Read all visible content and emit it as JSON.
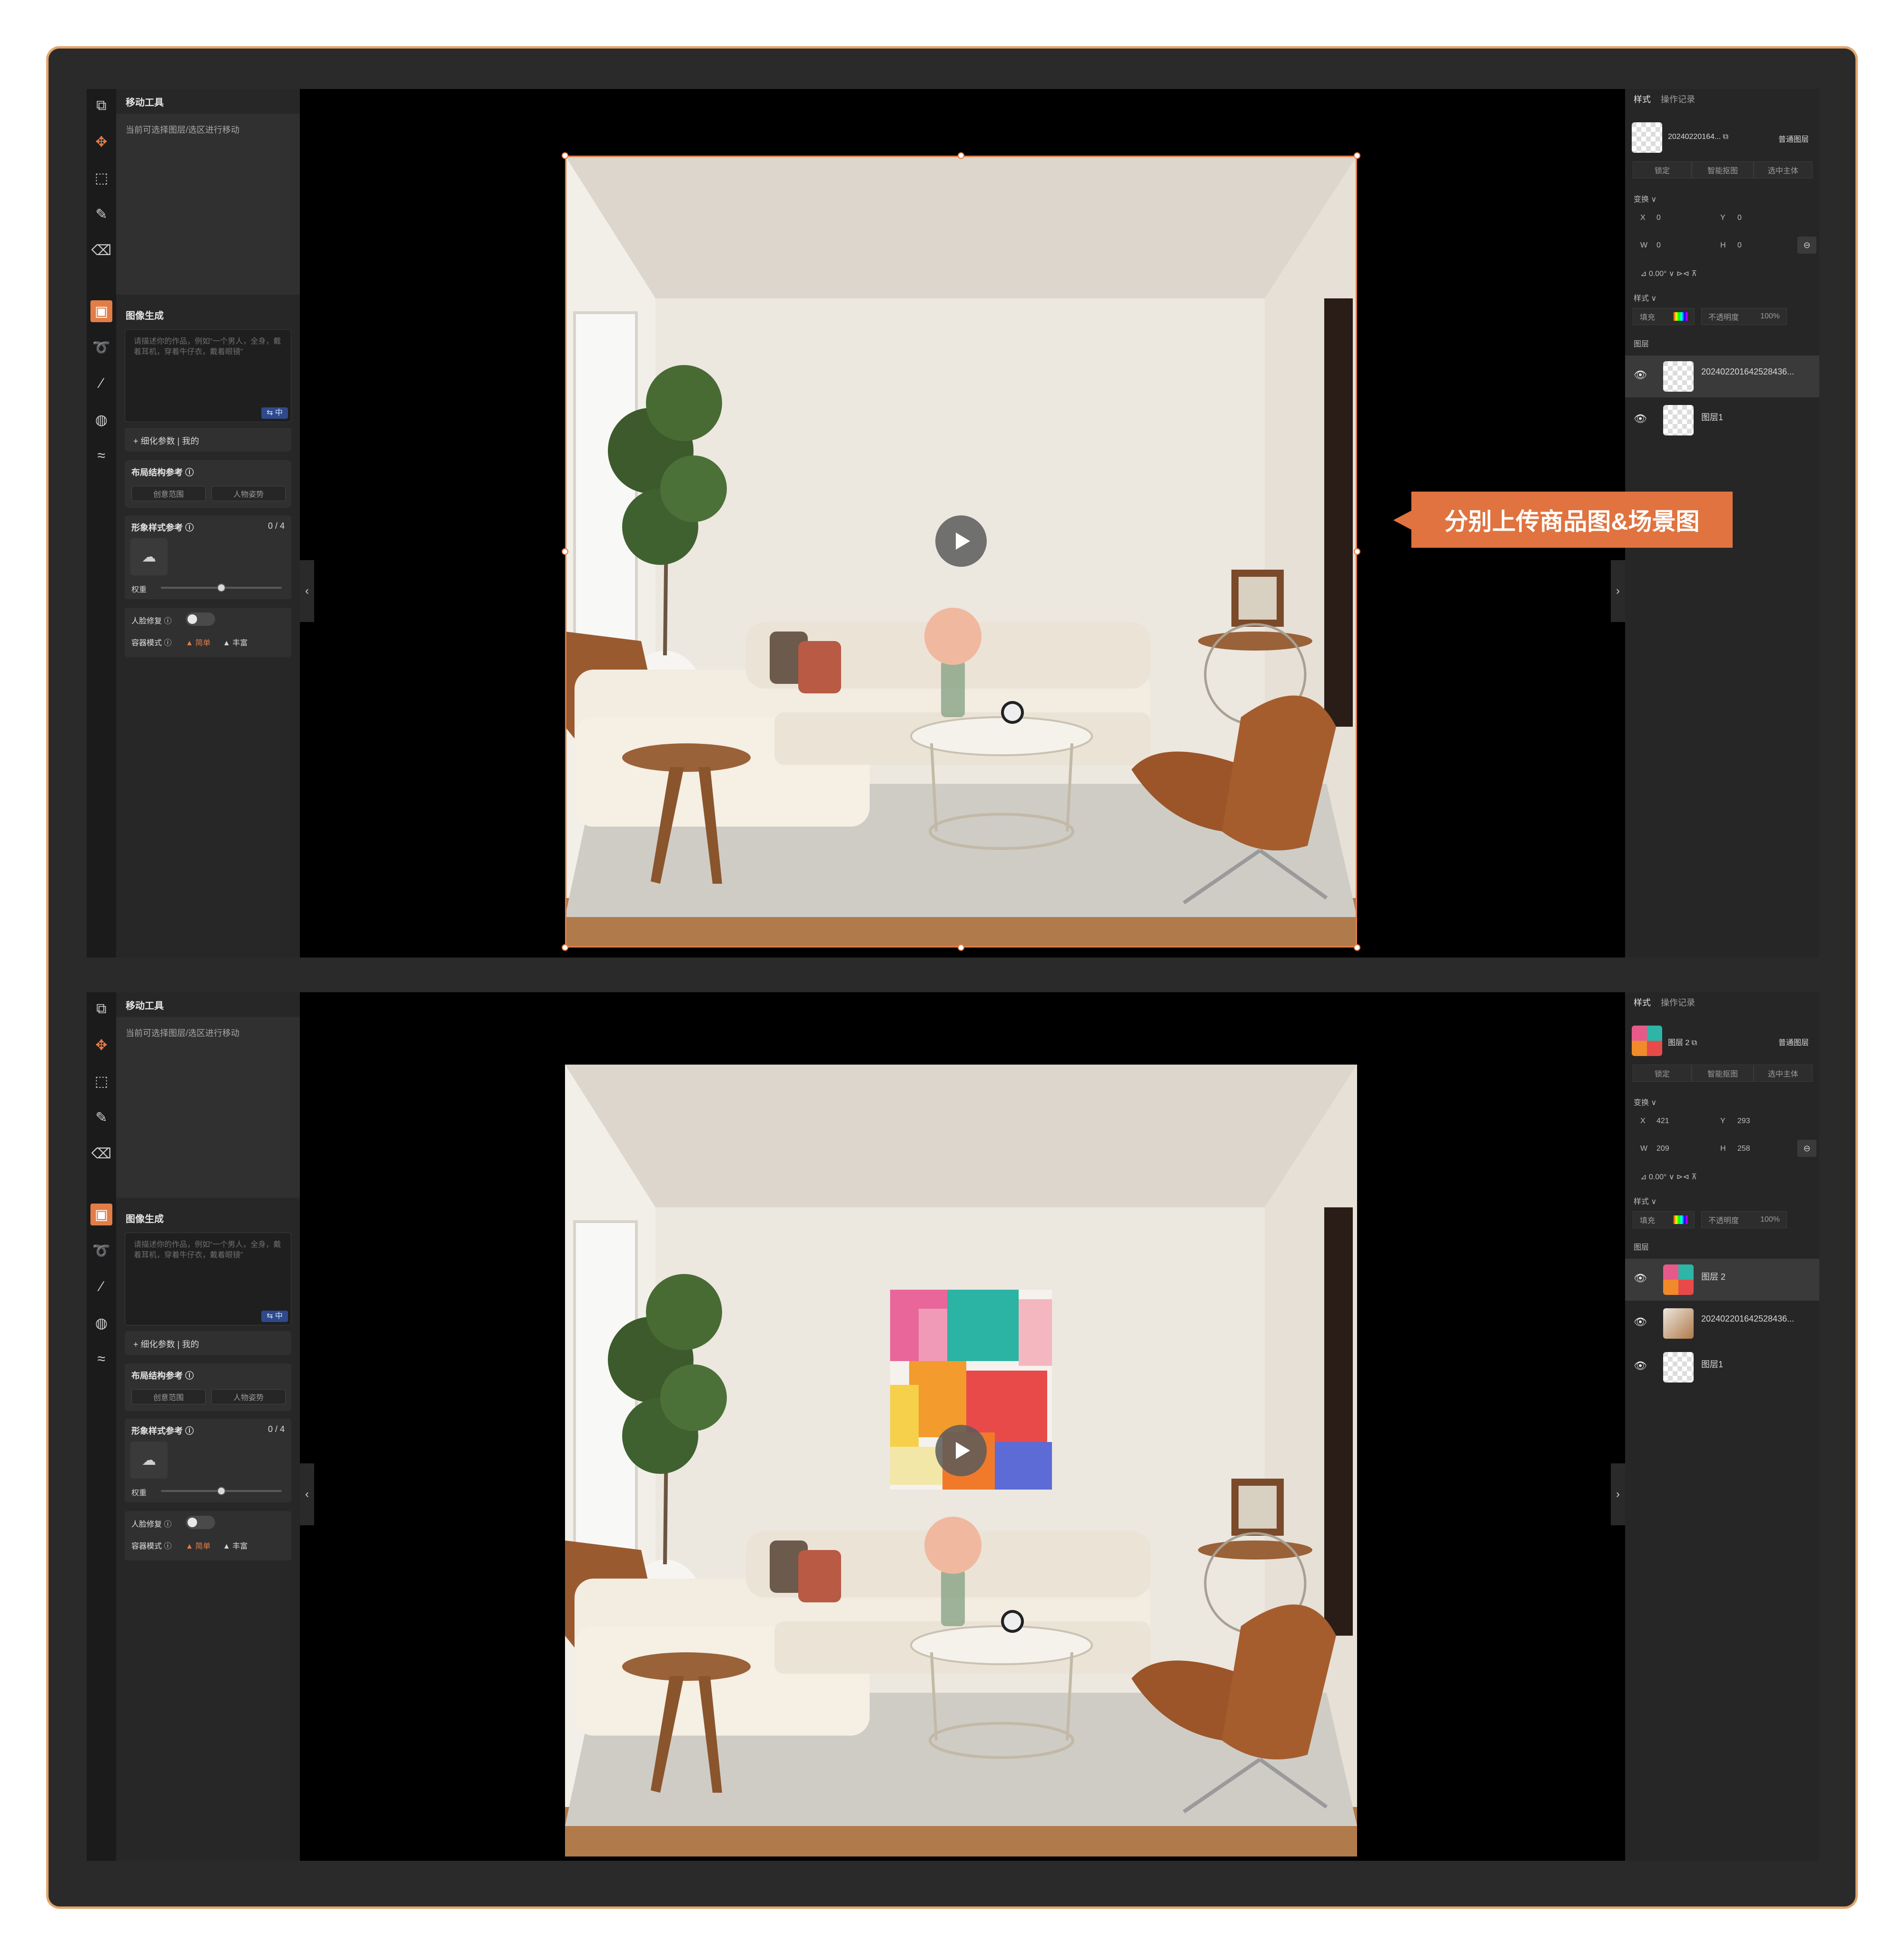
{
  "callout": "分别上传商品图&场景图",
  "left_panel": {
    "move_tool_title": "移动工具",
    "move_tool_hint": "当前可选择图层/选区进行移动",
    "image_gen_title": "图像生成",
    "prompt_placeholder": "请描述你的作品，例如“一个男人，全身，戴着耳机，穿着牛仔衣，戴着眼镜”",
    "lang_badge": "⇆ 中",
    "refine_params": "+ 细化参数 | 我的",
    "layout_ref": "布局结构参考 ⓘ",
    "layout_opt1": "创意范围",
    "layout_opt2": "人物姿势",
    "style_ref": "形象样式参考 ⓘ",
    "style_count": "0 / 4",
    "weight_label": "权重",
    "weight_value": 0.5,
    "face_fix": "人脸修复 ⓘ",
    "quality_mode_label": "容器模式 ⓘ",
    "quality_opt1": "▲ 简单",
    "quality_opt2": "▲ 丰富"
  },
  "top": {
    "tabs": [
      "样式",
      "操作记录"
    ],
    "layer_title": "20240220164... ⧉",
    "layer_type": "普通图层",
    "buttons": [
      "锁定",
      "智能抠图",
      "选中主体"
    ],
    "transform_label": "变换 ∨",
    "x_label": "X",
    "x": "0",
    "y_label": "Y",
    "y": "0",
    "w_label": "W",
    "w": "0",
    "h_label": "H",
    "h": "0",
    "angle": "⊿  0.00°  ∨   ⊳⊲  ⊼",
    "style_label": "样式 ∨",
    "blend": "填充",
    "opacity_label": "不透明度",
    "opacity": "100%",
    "layers_label": "图层",
    "layers": [
      "20240220164252843​6...",
      "图层1"
    ]
  },
  "bottom": {
    "tabs": [
      "样式",
      "操作记录"
    ],
    "layer_title": "图层 2 ⧉",
    "layer_type": "普通图层",
    "buttons": [
      "锁定",
      "智能抠图",
      "选中主体"
    ],
    "transform_label": "变换 ∨",
    "x_label": "X",
    "x": "421",
    "y_label": "Y",
    "y": "293",
    "w_label": "W",
    "w": "209",
    "h_label": "H",
    "h": "258",
    "angle": "⊿  0.00°  ∨   ⊳⊲  ⊼",
    "style_label": "样式 ∨",
    "blend": "填充",
    "opacity_label": "不透明度",
    "opacity": "100%",
    "layers_label": "图层",
    "layers": [
      "图层 2",
      "20240220164252843​6...",
      "图层1"
    ]
  },
  "icons": {
    "toolbar": [
      "image-edit-icon",
      "move-icon",
      "marquee-icon",
      "brush-icon",
      "eraser-icon",
      "image-gen-icon",
      "lasso-icon",
      "magic-wand-icon",
      "palette-icon",
      "wave-icon"
    ],
    "collapse_left": "‹",
    "collapse_right": "›"
  },
  "colors": {
    "accent": "#e27d47",
    "callout": "#e0733f",
    "frame_border": "#e1a56c"
  }
}
